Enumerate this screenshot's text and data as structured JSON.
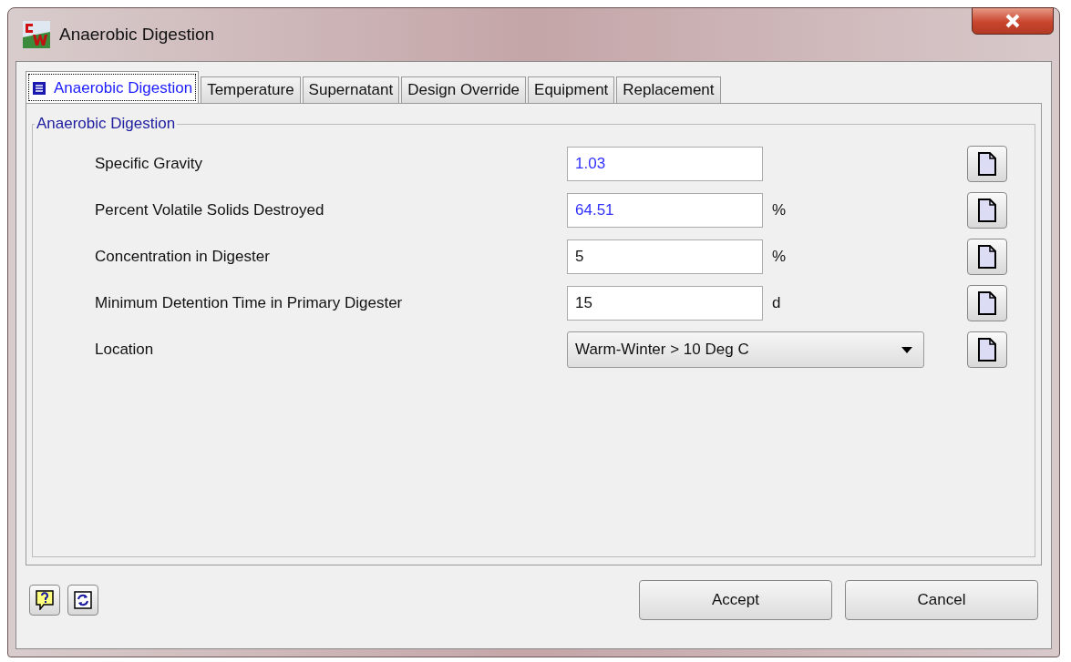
{
  "window": {
    "title": "Anaerobic Digestion"
  },
  "tabs": [
    {
      "label": "Anaerobic Digestion",
      "selected": true
    },
    {
      "label": "Temperature",
      "selected": false
    },
    {
      "label": "Supernatant",
      "selected": false
    },
    {
      "label": "Design Override",
      "selected": false
    },
    {
      "label": "Equipment",
      "selected": false
    },
    {
      "label": "Replacement",
      "selected": false
    }
  ],
  "group": {
    "title": "Anaerobic Digestion"
  },
  "fields": [
    {
      "kind": "input",
      "label": "Specific Gravity",
      "value": "1.03",
      "modified": true
    },
    {
      "kind": "input",
      "label": "Percent Volatile Solids Destroyed",
      "value": "64.51",
      "unit": "%",
      "modified": true
    },
    {
      "kind": "input",
      "label": "Concentration in Digester",
      "value": "5",
      "unit": "%",
      "modified": false
    },
    {
      "kind": "input",
      "label": "Minimum Detention Time in Primary Digester",
      "value": "15",
      "unit": "d",
      "modified": false
    },
    {
      "kind": "dropdown",
      "label": "Location",
      "value": "Warm-Winter > 10 Deg C"
    }
  ],
  "buttons": [
    {
      "label": "Accept"
    },
    {
      "label": "Cancel"
    }
  ]
}
